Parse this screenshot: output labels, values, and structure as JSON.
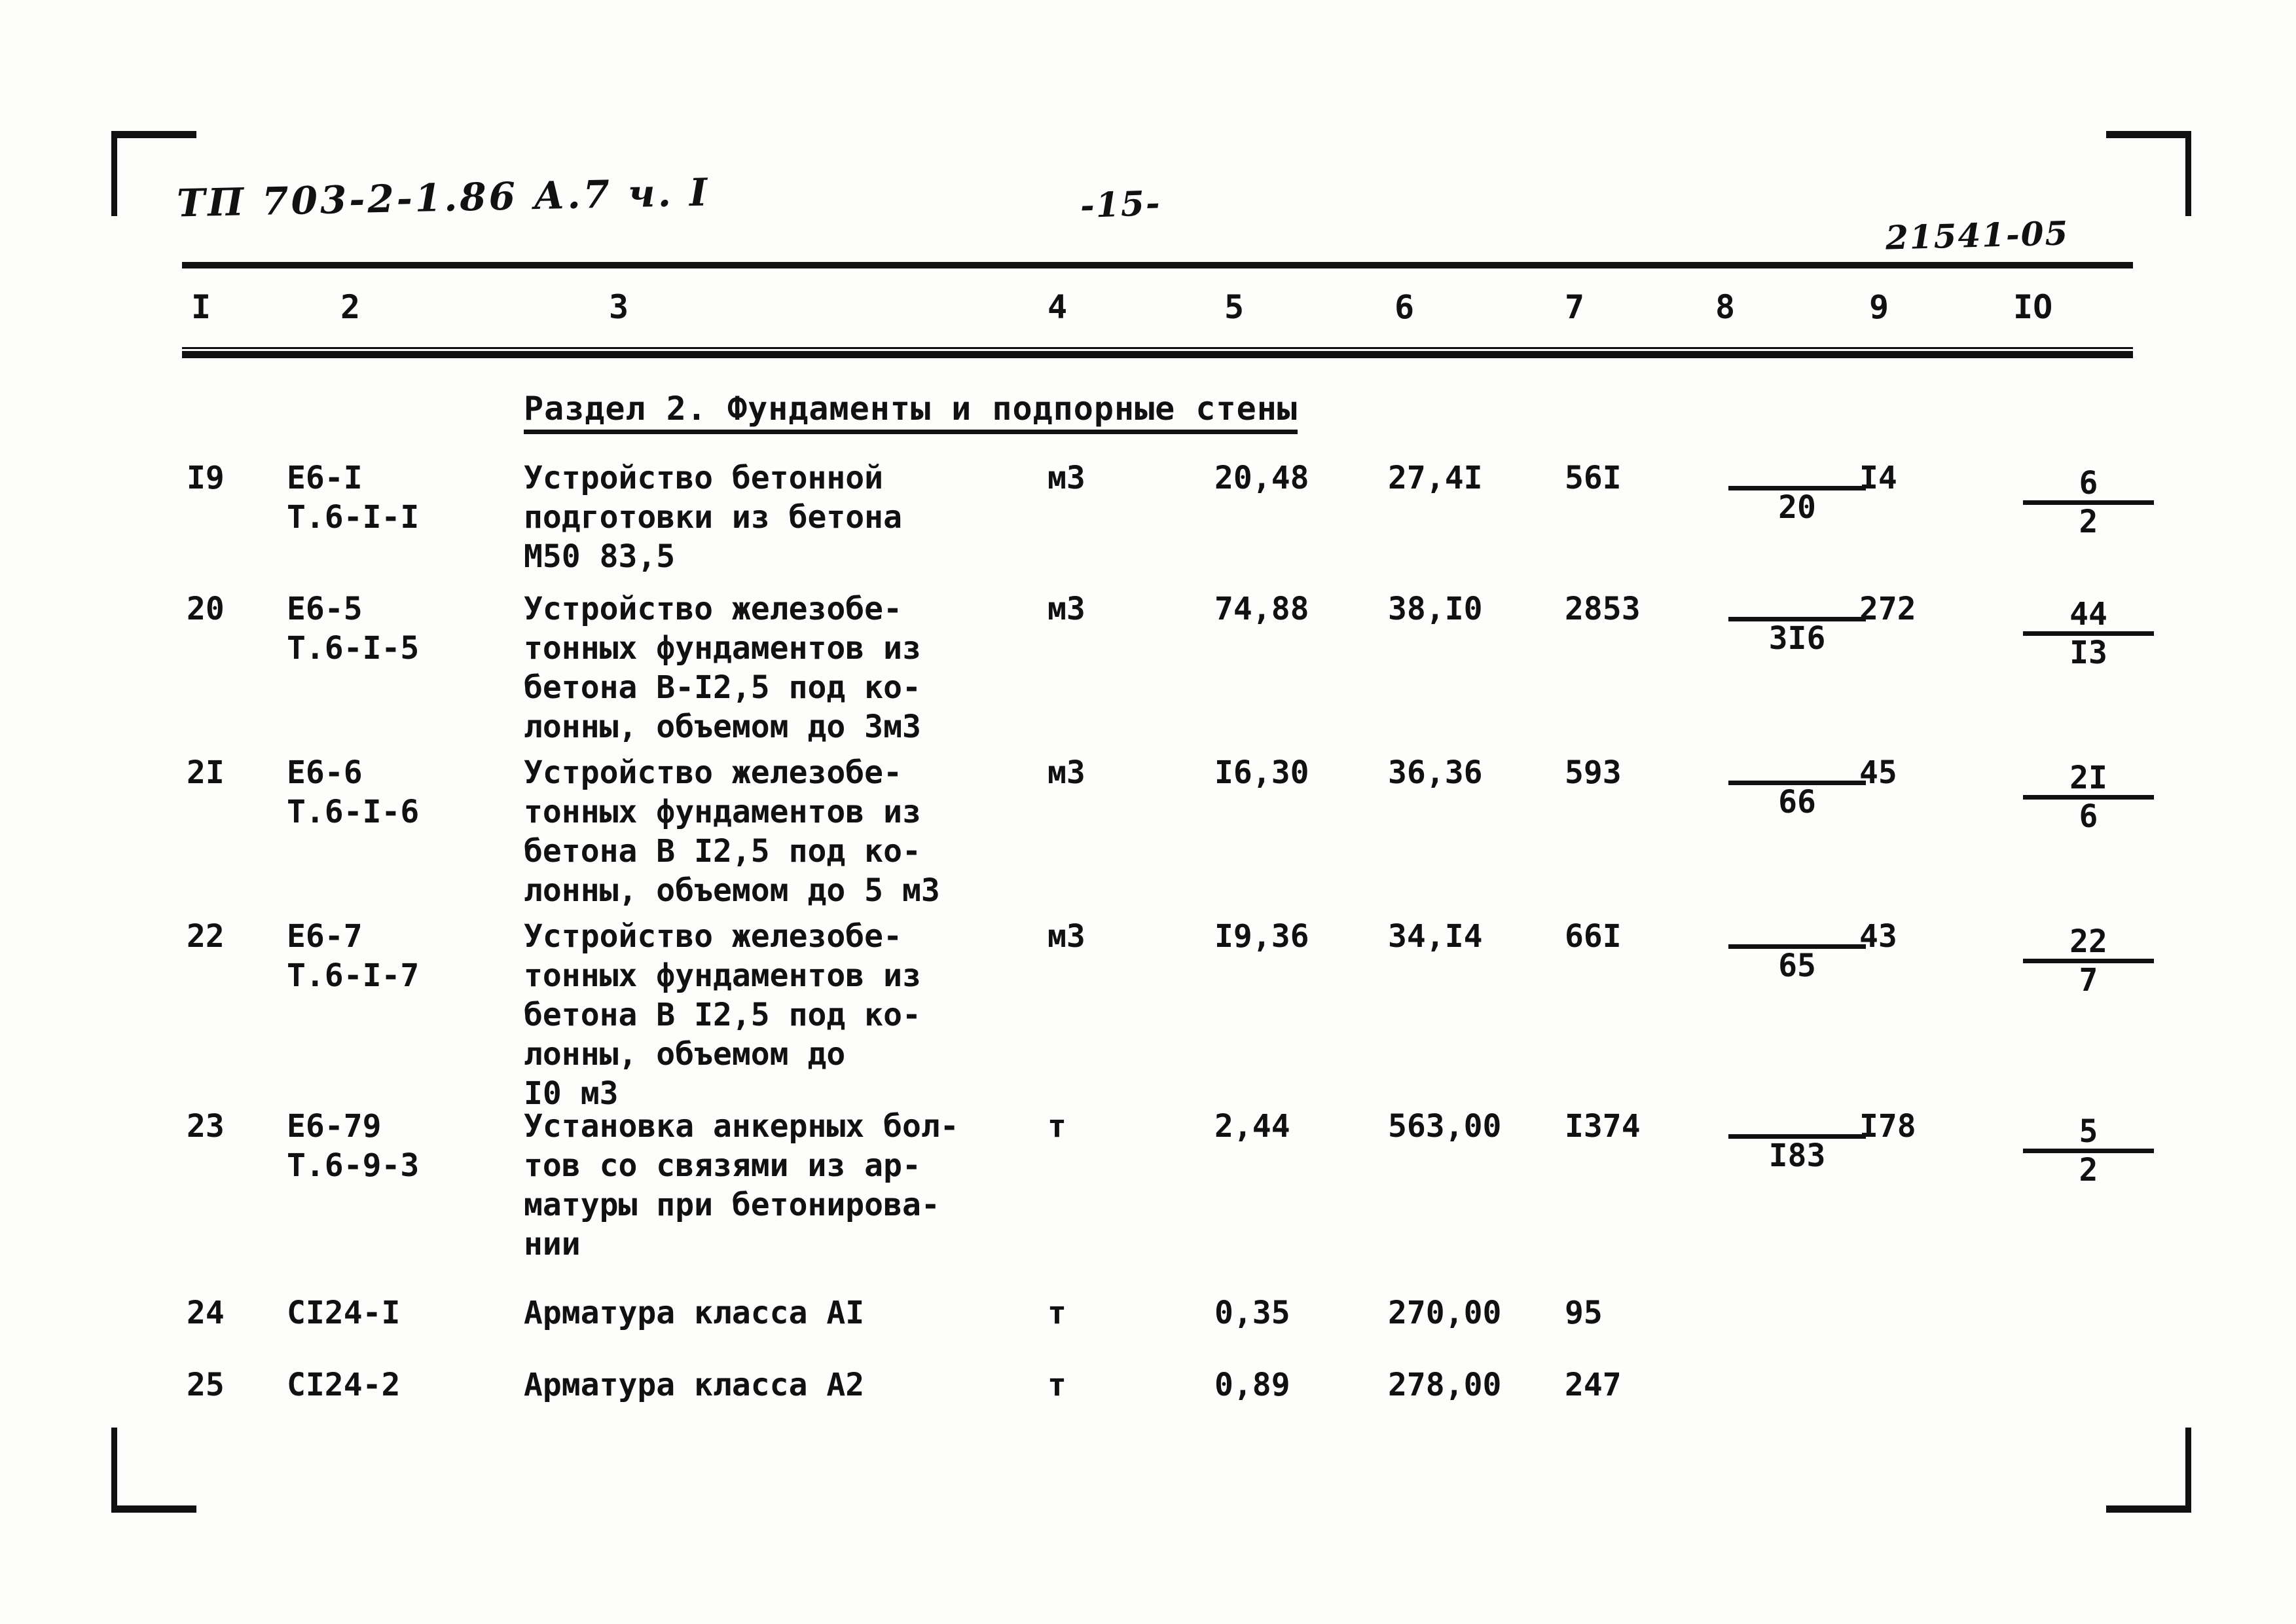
{
  "document": {
    "header_code": "ТП 703-2-1.86  А.7 ч. I",
    "page_number": "-15-",
    "sheet_code": "21541-05"
  },
  "table": {
    "column_headers": [
      "I",
      "2",
      "3",
      "4",
      "5",
      "6",
      "7",
      "8",
      "9",
      "IO"
    ],
    "section_title": "Раздел 2. Фундаменты и подпорные стены",
    "rows": [
      {
        "num": "I9",
        "code_line1": "Е6-I",
        "code_line2": "Т.6-I-I",
        "desc_line1": "Устройство бетонной",
        "desc_line2": "подготовки из бетона",
        "desc_line3": "М50 83,5",
        "desc_line4": "",
        "desc_line5": "",
        "unit": "м3",
        "qty": "20,48",
        "price": "27,4I",
        "total": "56I",
        "col8_top": "",
        "col8_bot": "20",
        "col9": "I4",
        "col10_top": "6",
        "col10_bot": "2"
      },
      {
        "num": "20",
        "code_line1": "Е6-5",
        "code_line2": "Т.6-I-5",
        "desc_line1": "Устройство железобе-",
        "desc_line2": "тонных фундаментов из",
        "desc_line3": "бетона В-I2,5 под ко-",
        "desc_line4": "лонны, объемом до 3м3",
        "desc_line5": "",
        "unit": "м3",
        "qty": "74,88",
        "price": "38,I0",
        "total": "2853",
        "col8_top": "",
        "col8_bot": "3I6",
        "col9": "272",
        "col10_top": "44",
        "col10_bot": "I3"
      },
      {
        "num": "2I",
        "code_line1": "Е6-6",
        "code_line2": "Т.6-I-6",
        "desc_line1": "Устройство железобе-",
        "desc_line2": "тонных фундаментов из",
        "desc_line3": "бетона В I2,5 под ко-",
        "desc_line4": "лонны, объемом до 5 м3",
        "desc_line5": "",
        "unit": "м3",
        "qty": "I6,30",
        "price": "36,36",
        "total": "593",
        "col8_top": "",
        "col8_bot": "66",
        "col9": "45",
        "col10_top": "2I",
        "col10_bot": "6"
      },
      {
        "num": "22",
        "code_line1": "Е6-7",
        "code_line2": "Т.6-I-7",
        "desc_line1": "Устройство железобе-",
        "desc_line2": "тонных фундаментов из",
        "desc_line3": "бетона В I2,5 под ко-",
        "desc_line4": "лонны, объемом до",
        "desc_line5": "I0 м3",
        "unit": "м3",
        "qty": "I9,36",
        "price": "34,I4",
        "total": "66I",
        "col8_top": "",
        "col8_bot": "65",
        "col9": "43",
        "col10_top": "22",
        "col10_bot": "7"
      },
      {
        "num": "23",
        "code_line1": "Е6-79",
        "code_line2": "Т.6-9-3",
        "desc_line1": "Установка анкерных бол-",
        "desc_line2": "тов со связями из ар-",
        "desc_line3": "матуры при бетонирова-",
        "desc_line4": "нии",
        "desc_line5": "",
        "unit": "т",
        "qty": "2,44",
        "price": "563,00",
        "total": "I374",
        "col8_top": "",
        "col8_bot": "I83",
        "col9": "I78",
        "col10_top": "5",
        "col10_bot": "2"
      },
      {
        "num": "24",
        "code_line1": "СI24-I",
        "code_line2": "",
        "desc_line1": "Арматура класса АI",
        "desc_line2": "",
        "desc_line3": "",
        "desc_line4": "",
        "desc_line5": "",
        "unit": "т",
        "qty": "0,35",
        "price": "270,00",
        "total": "95",
        "col8_top": "",
        "col8_bot": "",
        "col9": "",
        "col10_top": "",
        "col10_bot": ""
      },
      {
        "num": "25",
        "code_line1": "СI24-2",
        "code_line2": "",
        "desc_line1": "Арматура класса А2",
        "desc_line2": "",
        "desc_line3": "",
        "desc_line4": "",
        "desc_line5": "",
        "unit": "т",
        "qty": "0,89",
        "price": "278,00",
        "total": "247",
        "col8_top": "",
        "col8_bot": "",
        "col9": "",
        "col10_top": "",
        "col10_bot": ""
      }
    ]
  }
}
